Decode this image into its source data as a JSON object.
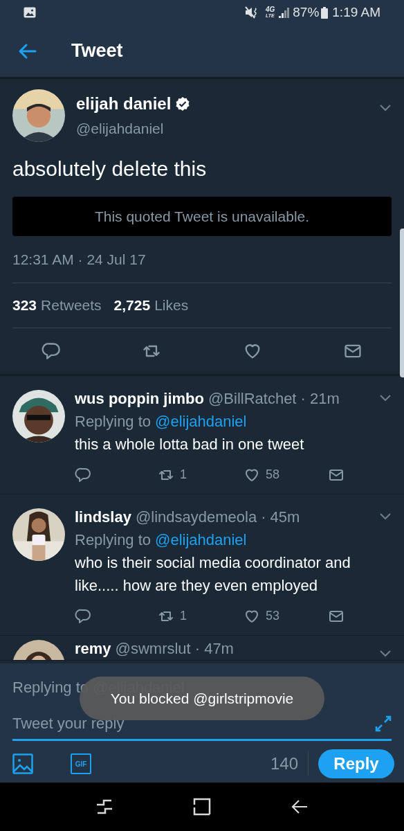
{
  "status_bar": {
    "network": "4G",
    "network_sub": "LTE",
    "battery": "87%",
    "time": "1:19 AM"
  },
  "header": {
    "title": "Tweet"
  },
  "tweet": {
    "name": "elijah daniel",
    "verified": true,
    "handle": "@elijahdaniel",
    "text": "absolutely delete this",
    "quoted_notice": "This quoted Tweet is unavailable.",
    "timestamp": "12:31 AM · 24 Jul 17",
    "stats": [
      {
        "count": "323",
        "label": "Retweets"
      },
      {
        "count": "2,725",
        "label": "Likes"
      }
    ]
  },
  "replies": [
    {
      "name": "wus poppin jimbo",
      "handle": "@BillRatchet",
      "time": "· 21m",
      "replying_label": "Replying to",
      "replying_to": "@elijahdaniel",
      "text": "this a whole lotta bad in one tweet",
      "retweets": "1",
      "likes": "58"
    },
    {
      "name": "lindslay",
      "handle": "@lindsaydemeola",
      "time": "· 45m",
      "replying_label": "Replying to",
      "replying_to": "@elijahdaniel",
      "text": "who is their social media coordinator and like..... how are they even employed",
      "retweets": "1",
      "likes": "53"
    },
    {
      "name": "remy",
      "handle": "@swmrslut",
      "time": "· 47m"
    }
  ],
  "composer": {
    "replying": "Replying to @elijahdaniel",
    "placeholder": "Tweet your reply",
    "gif_label": "GIF",
    "counter": "140",
    "button": "Reply"
  },
  "toast": {
    "text": "You blocked @girlstripmovie"
  }
}
